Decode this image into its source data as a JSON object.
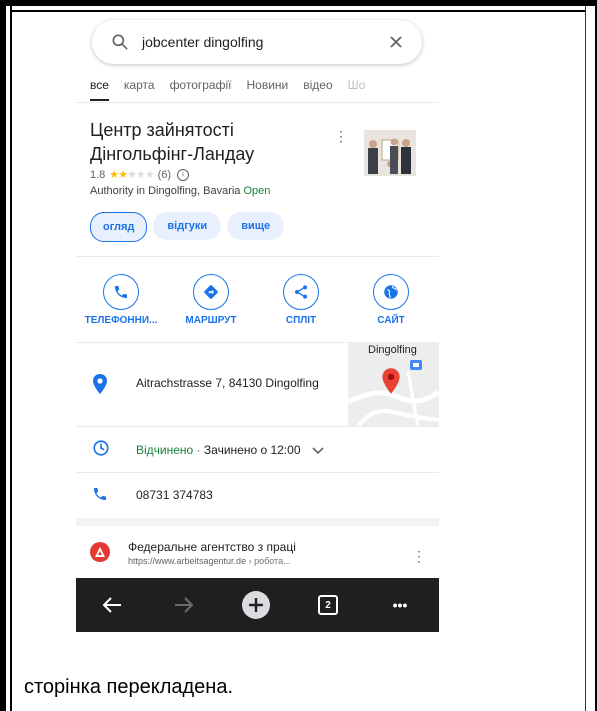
{
  "search": {
    "query": "jobcenter dingolfing",
    "icon": "search-icon",
    "clear_icon": "close-icon"
  },
  "tabs": [
    {
      "label": "все",
      "active": true
    },
    {
      "label": "карта",
      "active": false
    },
    {
      "label": "фотографії",
      "active": false
    },
    {
      "label": "Новини",
      "active": false
    },
    {
      "label": "відео",
      "active": false
    },
    {
      "label": "Шо",
      "active": false
    }
  ],
  "place": {
    "title_line1": "Центр зайнятості",
    "title_line2": "Дінгольфінг-Ландау",
    "rating": "1.8",
    "stars": "★★",
    "stars_off": "★★★",
    "review_count": "(6)",
    "category": "Authority in Dingolfing, Bavaria",
    "open_status": "Open"
  },
  "chips": [
    {
      "label": "огляд",
      "active": true
    },
    {
      "label": "відгуки",
      "active": false
    },
    {
      "label": "вище",
      "active": false
    }
  ],
  "actions": [
    {
      "label": "ТЕЛЕФОННИ...",
      "icon": "phone-icon"
    },
    {
      "label": "МАРШРУТ",
      "icon": "directions-icon"
    },
    {
      "label": "СПЛІТ",
      "icon": "share-icon"
    },
    {
      "label": "САЙТ",
      "icon": "globe-icon"
    }
  ],
  "address": {
    "text": "Aitrachstrasse 7, 84130 Dingolfing",
    "map_label": "Dingolfing"
  },
  "hours": {
    "open": "Відчинено",
    "separator": " · ",
    "closes": "Зачинено о 12:00"
  },
  "phone": {
    "number": "08731 374783"
  },
  "result": {
    "title": "Федеральне агентство з праці",
    "url": "https://www.arbeitsagentur.de",
    "path": " › робота..."
  },
  "toolbar": {
    "tab_count": "2",
    "more": "•••"
  },
  "caption": "сторінка перекладена.",
  "colors": {
    "accent": "#1a73e8",
    "open_green": "#188038",
    "star": "#fbbc04",
    "toolbar_bg": "#1f1f1f"
  }
}
